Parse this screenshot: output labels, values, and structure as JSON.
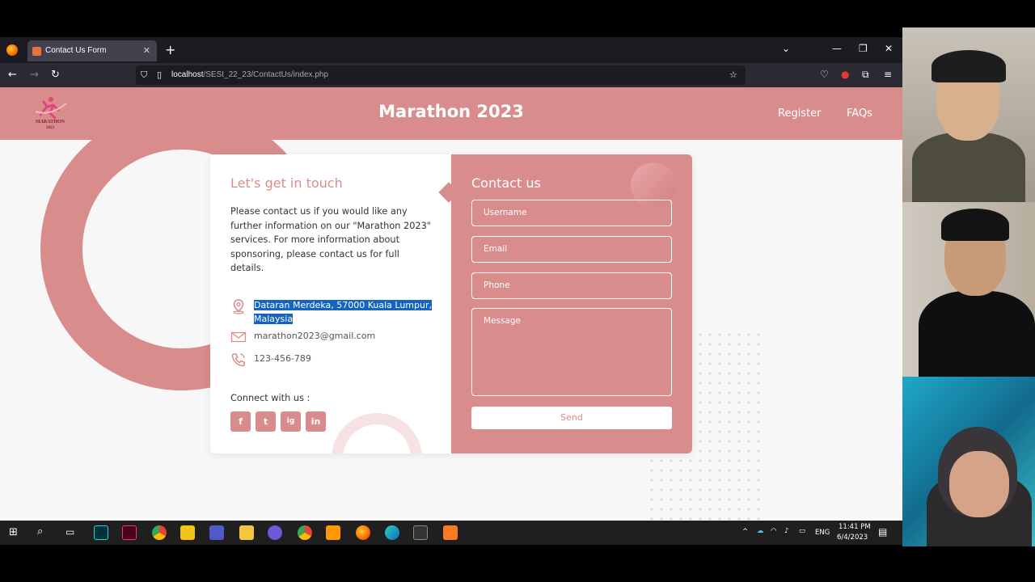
{
  "browser": {
    "tab_title": "Contact Us Form",
    "url_host": "localhost",
    "url_path": "/SESI_22_23/ContactUs/index.php"
  },
  "site": {
    "logo_text": "MARATHON",
    "logo_year": "2023",
    "title": "Marathon 2023",
    "nav": [
      "Register",
      "FAQs"
    ]
  },
  "contact_info": {
    "title": "Let's get in touch",
    "description": "Please contact us if you would like any further information on our \"Marathon 2023\" services. For more information about sponsoring, please contact us for full details.",
    "address_line1": "Dataran Merdeka, 57000 Kuala Lumpur,",
    "address_line2": "Malaysia",
    "email": "marathon2023@gmail.com",
    "phone": "123-456-789",
    "connect_label": "Connect with us :",
    "social": [
      "f",
      "t",
      "ig",
      "in"
    ]
  },
  "form": {
    "title": "Contact us",
    "username_placeholder": "Username",
    "email_placeholder": "Email",
    "phone_placeholder": "Phone",
    "message_placeholder": "Message",
    "submit_label": "Send"
  },
  "taskbar": {
    "lang": "ENG",
    "time": "11:41 PM",
    "date": "6/4/2023"
  },
  "colors": {
    "brand": "#d98c8c",
    "highlight": "#1565c0"
  }
}
